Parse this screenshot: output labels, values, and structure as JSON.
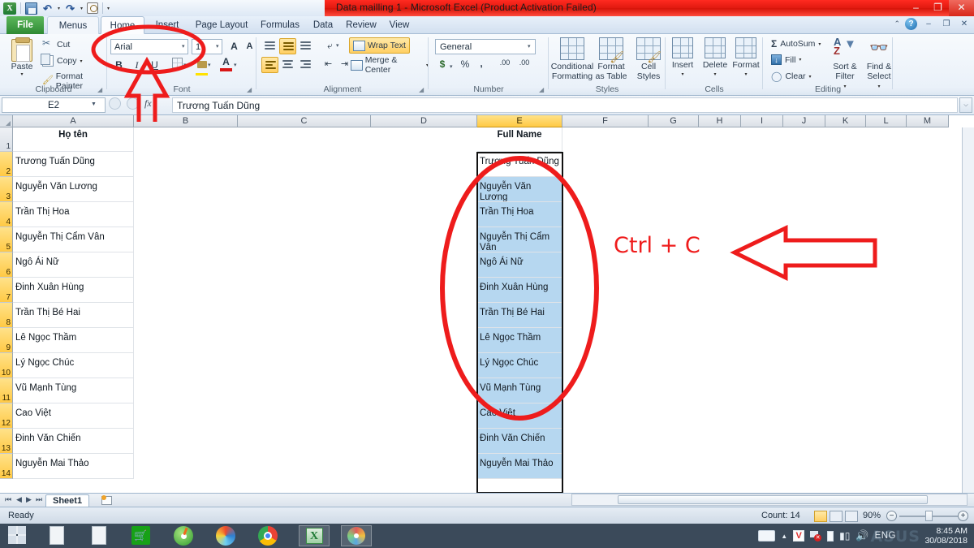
{
  "window": {
    "title": "Data mailling 1 - Microsoft Excel (Product Activation Failed)",
    "minimize": "–",
    "restore": "❐",
    "close": "✕",
    "accent_red": "#e21a10"
  },
  "quick_access": {
    "save": "save-icon",
    "undo": "↶",
    "redo": "↷",
    "print_preview": "print-preview-icon",
    "customize": "▾"
  },
  "ribbon": {
    "tabs": [
      {
        "label": "File"
      },
      {
        "label": "Menus"
      },
      {
        "label": "Home"
      },
      {
        "label": "Insert"
      },
      {
        "label": "Page Layout"
      },
      {
        "label": "Formulas"
      },
      {
        "label": "Data"
      },
      {
        "label": "Review"
      },
      {
        "label": "View"
      }
    ],
    "active_tab": "Home",
    "help_glyph": "?",
    "collapse_glyph": "⌃",
    "mini_minimize": "–",
    "mini_restore": "❐",
    "mini_close": "✕",
    "clipboard": {
      "group_label": "Clipboard",
      "paste": "Paste",
      "cut": "Cut",
      "copy": "Copy",
      "format_painter": "Format Painter",
      "dropdown": "▾"
    },
    "font": {
      "group_label": "Font",
      "font_name": "Arial",
      "font_size": "1",
      "grow_font": "A",
      "shrink_font": "A",
      "bold": "B",
      "italic": "I",
      "underline": "U",
      "borders": "borders-icon",
      "fill_color": "fill-color-icon",
      "font_color": "A",
      "dropdown": "▾"
    },
    "alignment": {
      "group_label": "Alignment",
      "wrap_text": "Wrap Text",
      "merge_center": "Merge & Center",
      "orientation": "orientation-icon",
      "decrease_indent": "decrease-indent-icon",
      "increase_indent": "increase-indent-icon",
      "dropdown": "▾"
    },
    "number": {
      "group_label": "Number",
      "format": "General",
      "currency": "$",
      "percent": "%",
      "comma": ",",
      "increase_decimal": ".00",
      "decrease_decimal": ".00",
      "dropdown": "▾"
    },
    "styles": {
      "group_label": "Styles",
      "conditional_formatting": "Conditional\nFormatting",
      "format_as_table": "Format\nas Table",
      "cell_styles": "Cell\nStyles",
      "cf_line1": "Conditional",
      "cf_line2": "Formatting",
      "ft_line1": "Format",
      "ft_line2": "as Table",
      "cs_line1": "Cell",
      "cs_line2": "Styles"
    },
    "cells": {
      "group_label": "Cells",
      "insert": "Insert",
      "delete": "Delete",
      "format": "Format"
    },
    "editing": {
      "group_label": "Editing",
      "autosum": "AutoSum",
      "autosum_sigma": "Σ",
      "fill": "Fill",
      "clear": "Clear",
      "sort_filter_l1": "Sort &",
      "sort_filter_l2": "Filter",
      "find_select_l1": "Find &",
      "find_select_l2": "Select"
    }
  },
  "formula_bar": {
    "name_box": "E2",
    "fx_label": "fx",
    "content": "Trương Tuấn Dũng",
    "expand_glyph": "⌵"
  },
  "sheet": {
    "columns": [
      "A",
      "B",
      "C",
      "D",
      "E",
      "F",
      "G",
      "H",
      "I",
      "J",
      "K",
      "L",
      "M"
    ],
    "selected_column": "E",
    "rows": [
      "1",
      "2",
      "3",
      "4",
      "5",
      "6",
      "7",
      "8",
      "9",
      "10",
      "11",
      "12",
      "13",
      "14"
    ],
    "header_a": "Họ tên",
    "header_e": "Full Name",
    "names": [
      "Trương Tuấn Dũng",
      "Nguyễn Văn Lương",
      "Trần Thị Hoa",
      "Nguyễn Thị Cẩm Vân",
      "Ngô Ái Nữ",
      "Đinh Xuân Hùng",
      "Trần Thị Bé Hai",
      "Lê Ngọc Thầm",
      "Lý Ngọc Chúc",
      "Vũ Mạnh Tùng",
      "Cao Việt",
      "Đinh Văn Chiến",
      "Nguyễn Mai Thảo"
    ]
  },
  "annotations": {
    "shortcut_text": "Ctrl + C",
    "annotation_color": "#ee1c1c",
    "ellipse_font_name": "font-name-highlight-ellipse",
    "ellipse_column_e": "column-e-highlight-ellipse",
    "arrow_up": "up-arrow-to-font-box",
    "arrow_left": "left-arrow-to-copy-range"
  },
  "sheet_tabs": {
    "first": "⏮",
    "prev": "◀",
    "next": "▶",
    "last": "⏭",
    "tabs": [
      "Sheet1"
    ],
    "new_sheet": "new-sheet-icon"
  },
  "status_bar": {
    "mode": "Ready",
    "count": "Count: 14",
    "zoom": "90%",
    "zoom_out": "−",
    "zoom_in": "+",
    "view_normal": "normal-view-icon",
    "view_page_layout": "page-layout-view-icon",
    "view_page_break": "page-break-view-icon"
  },
  "taskbar": {
    "start": "windows-start-icon",
    "items": [
      "document-icon",
      "document-icon",
      "store-icon",
      "media-player-icon",
      "browser-icon",
      "chrome-icon",
      "excel-icon",
      "paint-icon"
    ],
    "tray": {
      "keyboard": "keyboard-icon",
      "show_hidden": "▲",
      "antivirus": "V",
      "network_flag": "network-flag-icon",
      "battery": "battery-icon",
      "signal": "signal-icon",
      "volume": "volume-icon",
      "language": "ENG",
      "time": "8:45 AM",
      "date": "30/08/2018",
      "brand": "ASUS"
    }
  }
}
